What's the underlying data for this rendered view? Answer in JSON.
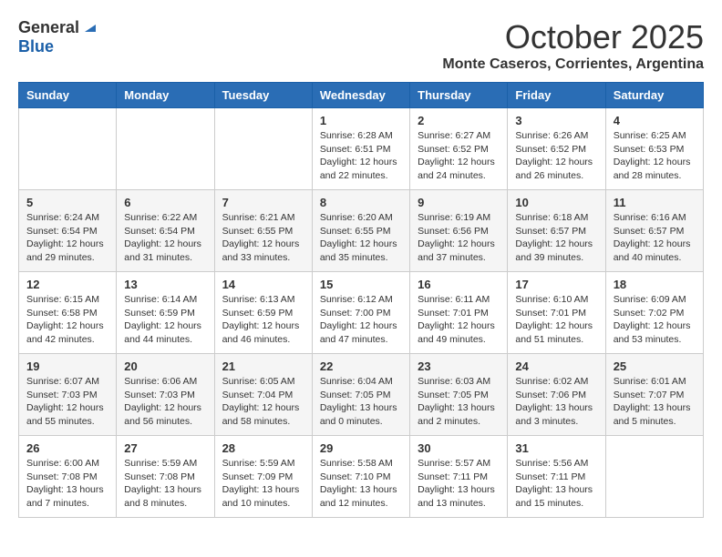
{
  "logo": {
    "general": "General",
    "blue": "Blue"
  },
  "title": "October 2025",
  "location": "Monte Caseros, Corrientes, Argentina",
  "headers": [
    "Sunday",
    "Monday",
    "Tuesday",
    "Wednesday",
    "Thursday",
    "Friday",
    "Saturday"
  ],
  "weeks": [
    [
      {
        "day": "",
        "info": ""
      },
      {
        "day": "",
        "info": ""
      },
      {
        "day": "",
        "info": ""
      },
      {
        "day": "1",
        "info": "Sunrise: 6:28 AM\nSunset: 6:51 PM\nDaylight: 12 hours\nand 22 minutes."
      },
      {
        "day": "2",
        "info": "Sunrise: 6:27 AM\nSunset: 6:52 PM\nDaylight: 12 hours\nand 24 minutes."
      },
      {
        "day": "3",
        "info": "Sunrise: 6:26 AM\nSunset: 6:52 PM\nDaylight: 12 hours\nand 26 minutes."
      },
      {
        "day": "4",
        "info": "Sunrise: 6:25 AM\nSunset: 6:53 PM\nDaylight: 12 hours\nand 28 minutes."
      }
    ],
    [
      {
        "day": "5",
        "info": "Sunrise: 6:24 AM\nSunset: 6:54 PM\nDaylight: 12 hours\nand 29 minutes."
      },
      {
        "day": "6",
        "info": "Sunrise: 6:22 AM\nSunset: 6:54 PM\nDaylight: 12 hours\nand 31 minutes."
      },
      {
        "day": "7",
        "info": "Sunrise: 6:21 AM\nSunset: 6:55 PM\nDaylight: 12 hours\nand 33 minutes."
      },
      {
        "day": "8",
        "info": "Sunrise: 6:20 AM\nSunset: 6:55 PM\nDaylight: 12 hours\nand 35 minutes."
      },
      {
        "day": "9",
        "info": "Sunrise: 6:19 AM\nSunset: 6:56 PM\nDaylight: 12 hours\nand 37 minutes."
      },
      {
        "day": "10",
        "info": "Sunrise: 6:18 AM\nSunset: 6:57 PM\nDaylight: 12 hours\nand 39 minutes."
      },
      {
        "day": "11",
        "info": "Sunrise: 6:16 AM\nSunset: 6:57 PM\nDaylight: 12 hours\nand 40 minutes."
      }
    ],
    [
      {
        "day": "12",
        "info": "Sunrise: 6:15 AM\nSunset: 6:58 PM\nDaylight: 12 hours\nand 42 minutes."
      },
      {
        "day": "13",
        "info": "Sunrise: 6:14 AM\nSunset: 6:59 PM\nDaylight: 12 hours\nand 44 minutes."
      },
      {
        "day": "14",
        "info": "Sunrise: 6:13 AM\nSunset: 6:59 PM\nDaylight: 12 hours\nand 46 minutes."
      },
      {
        "day": "15",
        "info": "Sunrise: 6:12 AM\nSunset: 7:00 PM\nDaylight: 12 hours\nand 47 minutes."
      },
      {
        "day": "16",
        "info": "Sunrise: 6:11 AM\nSunset: 7:01 PM\nDaylight: 12 hours\nand 49 minutes."
      },
      {
        "day": "17",
        "info": "Sunrise: 6:10 AM\nSunset: 7:01 PM\nDaylight: 12 hours\nand 51 minutes."
      },
      {
        "day": "18",
        "info": "Sunrise: 6:09 AM\nSunset: 7:02 PM\nDaylight: 12 hours\nand 53 minutes."
      }
    ],
    [
      {
        "day": "19",
        "info": "Sunrise: 6:07 AM\nSunset: 7:03 PM\nDaylight: 12 hours\nand 55 minutes."
      },
      {
        "day": "20",
        "info": "Sunrise: 6:06 AM\nSunset: 7:03 PM\nDaylight: 12 hours\nand 56 minutes."
      },
      {
        "day": "21",
        "info": "Sunrise: 6:05 AM\nSunset: 7:04 PM\nDaylight: 12 hours\nand 58 minutes."
      },
      {
        "day": "22",
        "info": "Sunrise: 6:04 AM\nSunset: 7:05 PM\nDaylight: 13 hours\nand 0 minutes."
      },
      {
        "day": "23",
        "info": "Sunrise: 6:03 AM\nSunset: 7:05 PM\nDaylight: 13 hours\nand 2 minutes."
      },
      {
        "day": "24",
        "info": "Sunrise: 6:02 AM\nSunset: 7:06 PM\nDaylight: 13 hours\nand 3 minutes."
      },
      {
        "day": "25",
        "info": "Sunrise: 6:01 AM\nSunset: 7:07 PM\nDaylight: 13 hours\nand 5 minutes."
      }
    ],
    [
      {
        "day": "26",
        "info": "Sunrise: 6:00 AM\nSunset: 7:08 PM\nDaylight: 13 hours\nand 7 minutes."
      },
      {
        "day": "27",
        "info": "Sunrise: 5:59 AM\nSunset: 7:08 PM\nDaylight: 13 hours\nand 8 minutes."
      },
      {
        "day": "28",
        "info": "Sunrise: 5:59 AM\nSunset: 7:09 PM\nDaylight: 13 hours\nand 10 minutes."
      },
      {
        "day": "29",
        "info": "Sunrise: 5:58 AM\nSunset: 7:10 PM\nDaylight: 13 hours\nand 12 minutes."
      },
      {
        "day": "30",
        "info": "Sunrise: 5:57 AM\nSunset: 7:11 PM\nDaylight: 13 hours\nand 13 minutes."
      },
      {
        "day": "31",
        "info": "Sunrise: 5:56 AM\nSunset: 7:11 PM\nDaylight: 13 hours\nand 15 minutes."
      },
      {
        "day": "",
        "info": ""
      }
    ]
  ]
}
